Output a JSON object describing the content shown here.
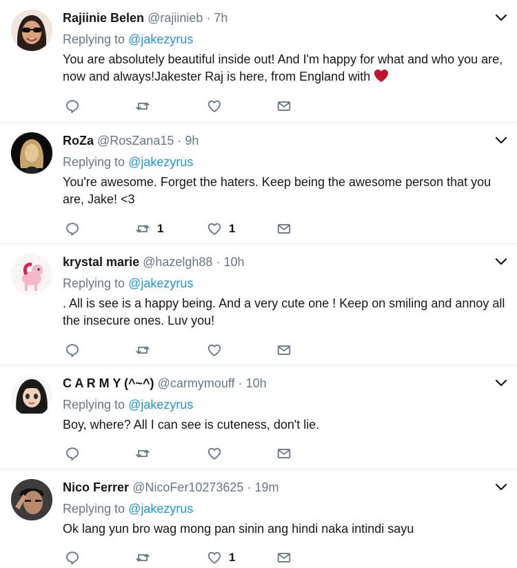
{
  "replying_label": "Replying to",
  "colors": {
    "accent": "#1b95e0",
    "muted": "#657786",
    "text": "#14171a",
    "heart": "#c0152f"
  },
  "tweets": [
    {
      "name": "Rajiinie Belen",
      "handle": "@rajiinieb",
      "sep": "·",
      "time": "7h",
      "reply_to": "@jakezyrus",
      "text": "You are absolutely beautiful inside out! And I'm happy for what and who you are, now and always!Jakester Raj is here, from England with",
      "text_emoji": "heart-emoji",
      "avatar_icon": "woman-sunglasses-avatar",
      "retweets": "",
      "likes": ""
    },
    {
      "name": "RoZa",
      "handle": "@RosZana15",
      "sep": "·",
      "time": "9h",
      "reply_to": "@jakezyrus",
      "text": "You're awesome. Forget the haters. Keep being the awesome person that you are, Jake! <3",
      "avatar_icon": "gold-hair-avatar",
      "retweets": "1",
      "likes": "1"
    },
    {
      "name": "krystal marie",
      "handle": "@hazelgh88",
      "sep": "·",
      "time": "10h",
      "reply_to": "@jakezyrus",
      "text": ". All is see is a happy being. And a very cute one !  Keep on smiling and annoy all the insecure ones. Luv you!",
      "avatar_icon": "pink-pony-avatar",
      "retweets": "",
      "likes": ""
    },
    {
      "name": "C A R M Y (^~^)",
      "handle": "@carmymouff",
      "sep": "·",
      "time": "10h",
      "reply_to": "@jakezyrus",
      "text": "Boy, where? All I can see is cuteness, don't lie.",
      "avatar_icon": "cartoon-girl-avatar",
      "retweets": "",
      "likes": ""
    },
    {
      "name": "Nico Ferrer",
      "handle": "@NicoFer10273625",
      "sep": "·",
      "time": "19m",
      "reply_to": "@jakezyrus",
      "text": "Ok lang yun bro wag mong pan sinin ang hindi naka intindi sayu",
      "avatar_icon": "man-selfie-avatar",
      "retweets": "",
      "likes": "1"
    }
  ]
}
